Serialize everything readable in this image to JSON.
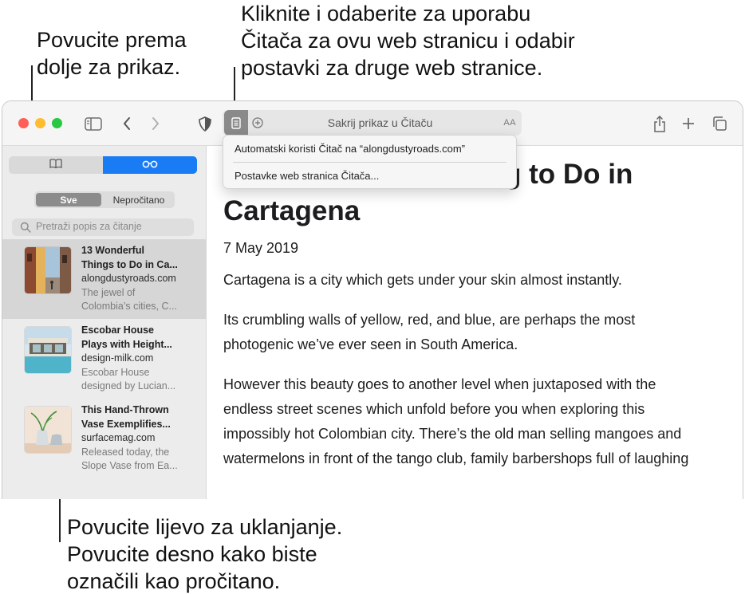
{
  "callouts": {
    "top_left": "Povucite prema\ndolje za prikaz.",
    "top_right": "Kliknite i odaberite za uporabu\nČitača za ovu web stranicu i odabir\npostavki za druge web stranice.",
    "bottom": "Povucite lijevo za uklanjanje.\nPovucite desno kako biste\noznačili kao pročitano."
  },
  "window": {
    "traffic_lights": {
      "close": "#ff5f57",
      "minimize": "#febc2e",
      "zoom": "#28c840"
    },
    "toolbar_icons": [
      "sidebar-icon",
      "back-icon",
      "forward-icon",
      "privacy-shield-icon",
      "share-icon",
      "new-tab-icon",
      "tab-overview-icon"
    ],
    "address_bar": {
      "reader_icon": "reader-icon",
      "extension_icon": "extension-icon",
      "title": "Sakrij prikaz u Čitaču",
      "text_size_label": "AA"
    }
  },
  "reader_menu": {
    "items": [
      {
        "label": "Automatski koristi Čitač na “alongdustyroads.com”"
      },
      {
        "label": "Postavke web stranica Čitača..."
      }
    ]
  },
  "sidebar": {
    "tabs": [
      {
        "icon": "bookmarks-icon",
        "selected": false
      },
      {
        "icon": "reading-list-icon",
        "selected": true
      }
    ],
    "accent_color": "#1a7cf5",
    "filter": [
      {
        "label": "Sve",
        "selected": true
      },
      {
        "label": "Nepročitano",
        "selected": false
      }
    ],
    "search_placeholder": "Pretraži popis za čitanje",
    "items": [
      {
        "title_line1": "13 Wonderful",
        "title_line2": "Things to Do in Ca...",
        "domain": "alongdustyroads.com",
        "summary_line1": "The jewel of",
        "summary_line2": "Colombia’s cities, C...",
        "selected": true,
        "thumb": "cartagena-street-photo"
      },
      {
        "title_line1": "Escobar House",
        "title_line2": "Plays with Height...",
        "domain": "design-milk.com",
        "summary_line1": "Escobar House",
        "summary_line2": "designed by Lucian...",
        "selected": false,
        "thumb": "house-pool-photo"
      },
      {
        "title_line1": "This Hand-Thrown",
        "title_line2": "Vase Exemplifies...",
        "domain": "surfacemag.com",
        "summary_line1": "Released today, the",
        "summary_line2": "Slope Vase from Ea...",
        "selected": false,
        "thumb": "vase-photo"
      }
    ]
  },
  "article": {
    "title_line1_visible": "g to Do in",
    "title_line2": "Cartagena",
    "date": "7 May 2019",
    "paragraphs": [
      {
        "lines": [
          "Cartagena is a city which gets under your skin almost instantly."
        ]
      },
      {
        "lines": [
          "Its crumbling walls of yellow, red, and blue, are perhaps the most",
          "photogenic we’ve ever seen in South America."
        ]
      },
      {
        "lines": [
          "However this beauty goes to another level when juxtaposed with the",
          "endless street scenes which unfold before you when exploring this",
          "impossibly hot Colombian city. There’s the old man selling mangoes and",
          "watermelons in front of the tango club, family barbershops full of laughing"
        ]
      }
    ]
  }
}
